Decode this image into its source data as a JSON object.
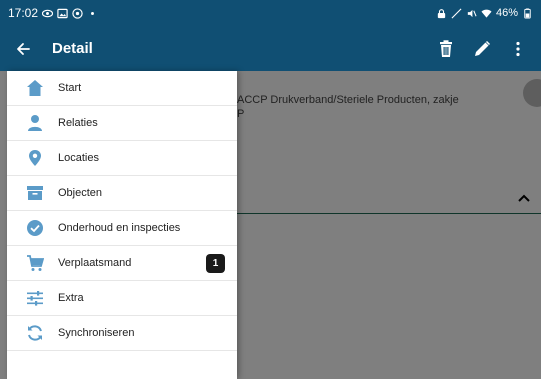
{
  "status_bar": {
    "time": "17:02",
    "battery": "46%"
  },
  "app_bar": {
    "title": "Detail",
    "icons": [
      "back-arrow-icon",
      "trash-icon",
      "pencil-icon",
      "more-vert-icon"
    ]
  },
  "content": {
    "description_line1": "ACCP Drukverband/Steriele Producten, zakje",
    "description_line2": "P"
  },
  "drawer": {
    "items": [
      {
        "label": "Start",
        "icon": "home-icon"
      },
      {
        "label": "Relaties",
        "icon": "person-icon"
      },
      {
        "label": "Locaties",
        "icon": "location-pin-icon"
      },
      {
        "label": "Objecten",
        "icon": "archive-box-icon"
      },
      {
        "label": "Onderhoud en inspecties",
        "icon": "check-circle-icon"
      },
      {
        "label": "Verplaatsmand",
        "icon": "cart-icon",
        "badge": "1"
      },
      {
        "label": "Extra",
        "icon": "sliders-icon"
      },
      {
        "label": "Synchroniseren",
        "icon": "sync-icon"
      }
    ]
  },
  "colors": {
    "app_bar": "#104f73",
    "icon_blue": "#5b9bc8",
    "divider_green": "#1e6a54"
  }
}
